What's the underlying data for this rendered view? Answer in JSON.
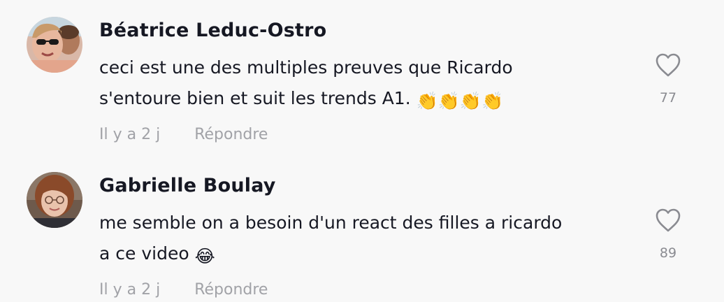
{
  "comments": [
    {
      "username": "Béatrice Leduc-Ostro",
      "text_line1": "ceci est une des multiples preuves que Ricardo",
      "text_line2": "s'entoure bien et suit les trends A1.",
      "emoji": "👏👏👏👏",
      "emoji_icon": "clapping-hands-icon",
      "time": "Il y a 2 j",
      "reply_label": "Répondre",
      "likes": "77",
      "like_icon": "heart-outline-icon"
    },
    {
      "username": "Gabrielle Boulay",
      "text_line1": "me semble on a besoin d'un react des filles a ricardo",
      "text_line2": "a ce video",
      "emoji": "😂",
      "emoji_icon": "tears-of-joy-icon",
      "time": "Il y a 2 j",
      "reply_label": "Répondre",
      "likes": "89",
      "like_icon": "heart-outline-icon"
    }
  ],
  "colors": {
    "background": "#f8f8f8",
    "text": "#161823",
    "muted": "#a1a2a7",
    "heart": "#8a8b91"
  }
}
